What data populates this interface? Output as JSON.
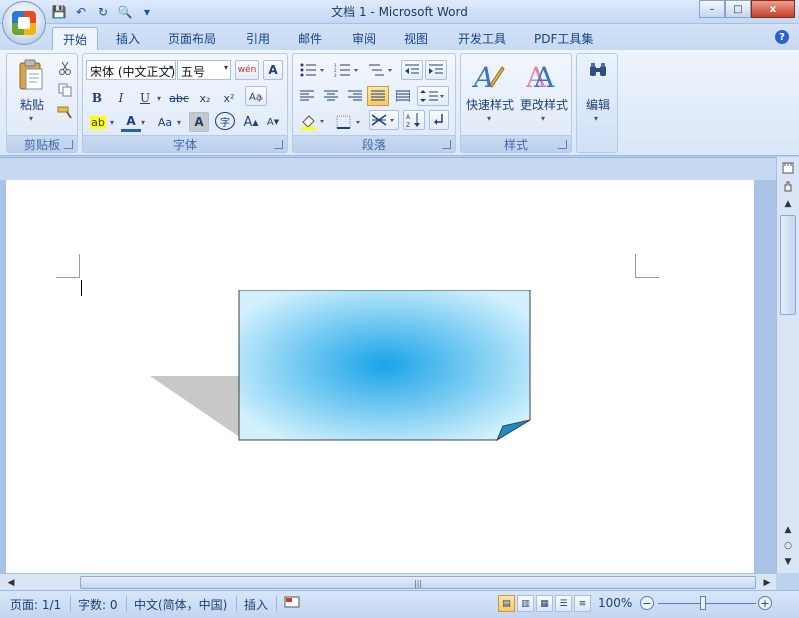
{
  "window": {
    "title": "文档 1 - Microsoft Word",
    "minimize": "–",
    "maximize": "□",
    "close": "x"
  },
  "quick_access": {
    "save": "💾",
    "undo": "↶",
    "redo": "↻",
    "print_preview": "🔍",
    "customize": "▾"
  },
  "tabs": [
    {
      "label": "开始",
      "active": true
    },
    {
      "label": "插入"
    },
    {
      "label": "页面布局"
    },
    {
      "label": "引用"
    },
    {
      "label": "邮件"
    },
    {
      "label": "审阅"
    },
    {
      "label": "视图"
    },
    {
      "label": "开发工具"
    },
    {
      "label": "PDF工具集"
    }
  ],
  "help": "?",
  "ribbon": {
    "clipboard": {
      "label": "剪贴板",
      "paste": "粘贴"
    },
    "font": {
      "label": "字体",
      "font_name": "宋体 (中文正文)",
      "font_size": "五号",
      "bold": "B",
      "italic": "I",
      "underline": "U",
      "strikethrough": "abc",
      "subscript": "x₂",
      "superscript": "x²",
      "grow": "A",
      "shrink": "A",
      "change_case": "Aa",
      "font_color": "A",
      "char_shading": "A",
      "enclose": "字",
      "phonetic": "wén",
      "char_border": "A",
      "highlight": "ab"
    },
    "paragraph": {
      "label": "段落"
    },
    "styles": {
      "label": "样式",
      "quick_styles": "快速样式",
      "change_styles": "更改样式"
    },
    "editing": {
      "label": "编辑"
    }
  },
  "colors": {
    "accent": "#15428b",
    "shape_center": "#1aa3e8",
    "shape_edge": "#d2f1fd",
    "shadow": "#c8c8c8",
    "fold": "#1a8ccb"
  },
  "status": {
    "page": "页面: 1/1",
    "words": "字数: 0",
    "language": "中文(简体，中国)",
    "mode": "插入",
    "zoom": "100%"
  },
  "zoom_minus": "−",
  "zoom_plus": "+",
  "hscroll_grip": "|||"
}
